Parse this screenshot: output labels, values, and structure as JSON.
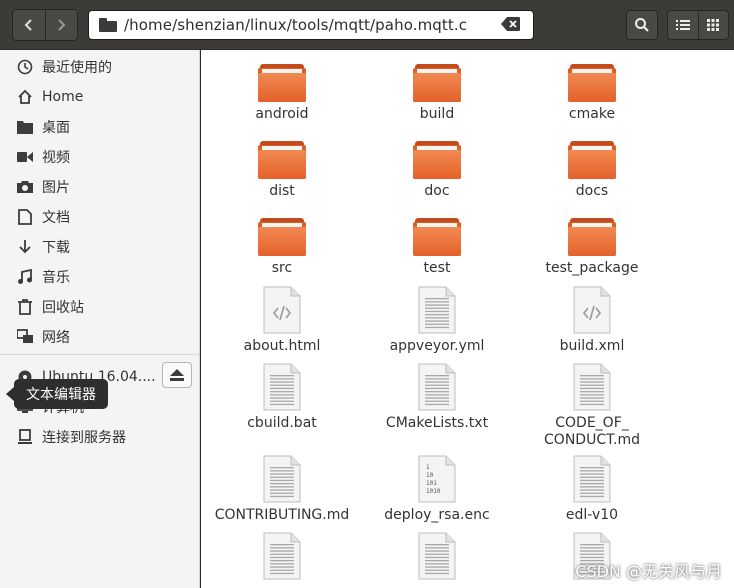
{
  "header": {
    "back_icon": "chevron-left-icon",
    "forward_icon": "chevron-right-icon",
    "path": "/home/shenzian/linux/tools/mqtt/paho.mqtt.c",
    "search_icon": "search-icon",
    "list_view_icon": "list-view-icon",
    "grid_view_icon": "grid-view-icon"
  },
  "sidebar": {
    "items": [
      {
        "label": "最近使用的",
        "icon": "clock-icon"
      },
      {
        "label": "Home",
        "icon": "home-icon"
      },
      {
        "label": "桌面",
        "icon": "desktop-folder-icon"
      },
      {
        "label": "视频",
        "icon": "video-icon"
      },
      {
        "label": "图片",
        "icon": "camera-icon"
      },
      {
        "label": "文档",
        "icon": "document-icon"
      },
      {
        "label": "下载",
        "icon": "download-icon"
      },
      {
        "label": "音乐",
        "icon": "music-icon"
      },
      {
        "label": "回收站",
        "icon": "trash-icon"
      },
      {
        "label": "网络",
        "icon": "network-icon"
      }
    ],
    "devices": [
      {
        "label": "Ubuntu 16.04....",
        "icon": "disc-icon"
      },
      {
        "label": "计算机",
        "icon": "computer-icon"
      },
      {
        "label": "连接到服务器",
        "icon": "server-connect-icon"
      }
    ],
    "tooltip": "文本编辑器"
  },
  "files": [
    {
      "name": "android",
      "type": "folder"
    },
    {
      "name": "build",
      "type": "folder"
    },
    {
      "name": "cmake",
      "type": "folder"
    },
    {
      "name": "dist",
      "type": "folder"
    },
    {
      "name": "doc",
      "type": "folder"
    },
    {
      "name": "docs",
      "type": "folder"
    },
    {
      "name": "src",
      "type": "folder"
    },
    {
      "name": "test",
      "type": "folder"
    },
    {
      "name": "test_package",
      "type": "folder"
    },
    {
      "name": "about.html",
      "type": "code"
    },
    {
      "name": "appveyor.yml",
      "type": "text"
    },
    {
      "name": "build.xml",
      "type": "code"
    },
    {
      "name": "cbuild.bat",
      "type": "text"
    },
    {
      "name": "CMakeLists.txt",
      "type": "text"
    },
    {
      "name": "CODE_OF_\nCONDUCT.md",
      "type": "text"
    },
    {
      "name": "CONTRIBUTING.md",
      "type": "text"
    },
    {
      "name": "deploy_rsa.enc",
      "type": "binary"
    },
    {
      "name": "edl-v10",
      "type": "text"
    },
    {
      "name": "",
      "type": "text"
    },
    {
      "name": "",
      "type": "text"
    },
    {
      "name": "",
      "type": "text"
    }
  ],
  "watermark": "CSDN @无关风与月"
}
